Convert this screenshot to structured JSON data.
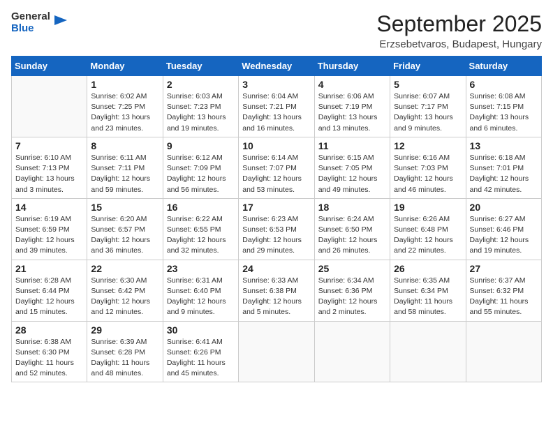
{
  "logo": {
    "general": "General",
    "blue": "Blue"
  },
  "header": {
    "month": "September 2025",
    "location": "Erzsebetvaros, Budapest, Hungary"
  },
  "weekdays": [
    "Sunday",
    "Monday",
    "Tuesday",
    "Wednesday",
    "Thursday",
    "Friday",
    "Saturday"
  ],
  "weeks": [
    [
      {
        "day": "",
        "info": ""
      },
      {
        "day": "1",
        "info": "Sunrise: 6:02 AM\nSunset: 7:25 PM\nDaylight: 13 hours\nand 23 minutes."
      },
      {
        "day": "2",
        "info": "Sunrise: 6:03 AM\nSunset: 7:23 PM\nDaylight: 13 hours\nand 19 minutes."
      },
      {
        "day": "3",
        "info": "Sunrise: 6:04 AM\nSunset: 7:21 PM\nDaylight: 13 hours\nand 16 minutes."
      },
      {
        "day": "4",
        "info": "Sunrise: 6:06 AM\nSunset: 7:19 PM\nDaylight: 13 hours\nand 13 minutes."
      },
      {
        "day": "5",
        "info": "Sunrise: 6:07 AM\nSunset: 7:17 PM\nDaylight: 13 hours\nand 9 minutes."
      },
      {
        "day": "6",
        "info": "Sunrise: 6:08 AM\nSunset: 7:15 PM\nDaylight: 13 hours\nand 6 minutes."
      }
    ],
    [
      {
        "day": "7",
        "info": "Sunrise: 6:10 AM\nSunset: 7:13 PM\nDaylight: 13 hours\nand 3 minutes."
      },
      {
        "day": "8",
        "info": "Sunrise: 6:11 AM\nSunset: 7:11 PM\nDaylight: 12 hours\nand 59 minutes."
      },
      {
        "day": "9",
        "info": "Sunrise: 6:12 AM\nSunset: 7:09 PM\nDaylight: 12 hours\nand 56 minutes."
      },
      {
        "day": "10",
        "info": "Sunrise: 6:14 AM\nSunset: 7:07 PM\nDaylight: 12 hours\nand 53 minutes."
      },
      {
        "day": "11",
        "info": "Sunrise: 6:15 AM\nSunset: 7:05 PM\nDaylight: 12 hours\nand 49 minutes."
      },
      {
        "day": "12",
        "info": "Sunrise: 6:16 AM\nSunset: 7:03 PM\nDaylight: 12 hours\nand 46 minutes."
      },
      {
        "day": "13",
        "info": "Sunrise: 6:18 AM\nSunset: 7:01 PM\nDaylight: 12 hours\nand 42 minutes."
      }
    ],
    [
      {
        "day": "14",
        "info": "Sunrise: 6:19 AM\nSunset: 6:59 PM\nDaylight: 12 hours\nand 39 minutes."
      },
      {
        "day": "15",
        "info": "Sunrise: 6:20 AM\nSunset: 6:57 PM\nDaylight: 12 hours\nand 36 minutes."
      },
      {
        "day": "16",
        "info": "Sunrise: 6:22 AM\nSunset: 6:55 PM\nDaylight: 12 hours\nand 32 minutes."
      },
      {
        "day": "17",
        "info": "Sunrise: 6:23 AM\nSunset: 6:53 PM\nDaylight: 12 hours\nand 29 minutes."
      },
      {
        "day": "18",
        "info": "Sunrise: 6:24 AM\nSunset: 6:50 PM\nDaylight: 12 hours\nand 26 minutes."
      },
      {
        "day": "19",
        "info": "Sunrise: 6:26 AM\nSunset: 6:48 PM\nDaylight: 12 hours\nand 22 minutes."
      },
      {
        "day": "20",
        "info": "Sunrise: 6:27 AM\nSunset: 6:46 PM\nDaylight: 12 hours\nand 19 minutes."
      }
    ],
    [
      {
        "day": "21",
        "info": "Sunrise: 6:28 AM\nSunset: 6:44 PM\nDaylight: 12 hours\nand 15 minutes."
      },
      {
        "day": "22",
        "info": "Sunrise: 6:30 AM\nSunset: 6:42 PM\nDaylight: 12 hours\nand 12 minutes."
      },
      {
        "day": "23",
        "info": "Sunrise: 6:31 AM\nSunset: 6:40 PM\nDaylight: 12 hours\nand 9 minutes."
      },
      {
        "day": "24",
        "info": "Sunrise: 6:33 AM\nSunset: 6:38 PM\nDaylight: 12 hours\nand 5 minutes."
      },
      {
        "day": "25",
        "info": "Sunrise: 6:34 AM\nSunset: 6:36 PM\nDaylight: 12 hours\nand 2 minutes."
      },
      {
        "day": "26",
        "info": "Sunrise: 6:35 AM\nSunset: 6:34 PM\nDaylight: 11 hours\nand 58 minutes."
      },
      {
        "day": "27",
        "info": "Sunrise: 6:37 AM\nSunset: 6:32 PM\nDaylight: 11 hours\nand 55 minutes."
      }
    ],
    [
      {
        "day": "28",
        "info": "Sunrise: 6:38 AM\nSunset: 6:30 PM\nDaylight: 11 hours\nand 52 minutes."
      },
      {
        "day": "29",
        "info": "Sunrise: 6:39 AM\nSunset: 6:28 PM\nDaylight: 11 hours\nand 48 minutes."
      },
      {
        "day": "30",
        "info": "Sunrise: 6:41 AM\nSunset: 6:26 PM\nDaylight: 11 hours\nand 45 minutes."
      },
      {
        "day": "",
        "info": ""
      },
      {
        "day": "",
        "info": ""
      },
      {
        "day": "",
        "info": ""
      },
      {
        "day": "",
        "info": ""
      }
    ]
  ]
}
